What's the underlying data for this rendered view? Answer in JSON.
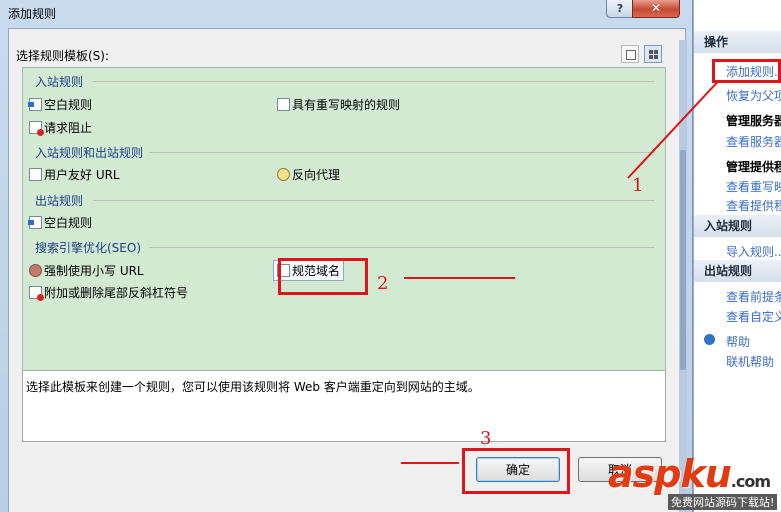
{
  "dialog": {
    "title": "添加规则",
    "help_glyph": "?",
    "close_glyph": "✕",
    "template_label": "选择规则模板(S):",
    "groups": [
      {
        "label": "入站规则",
        "items": [
          "空白规则",
          "具有重写映射的规则",
          "请求阻止"
        ]
      },
      {
        "label": "入站规则和出站规则",
        "items": [
          "用户友好 URL",
          "反向代理"
        ]
      },
      {
        "label": "出站规则",
        "items": [
          "空白规则"
        ]
      },
      {
        "label": "搜索引擎优化(SEO)",
        "items": [
          "强制使用小写 URL",
          "规范域名",
          "附加或删除尾部反斜杠符号"
        ]
      }
    ],
    "description": "选择此模板来创建一个规则，您可以使用该规则将 Web 客户端重定向到网站的主域。",
    "ok_label": "确定",
    "cancel_label": "取消"
  },
  "actions_panel": {
    "header": "操作",
    "add_rule": "添加规则...",
    "restore": "恢复为父项",
    "manage_server_vars": "管理服务器",
    "view_server_vars": "查看服务器",
    "manage_providers": "管理提供程",
    "view_rewrite_maps": "查看重写映",
    "view_providers": "查看提供程",
    "inbound_header": "入站规则",
    "import_rules": "导入规则...",
    "outbound_header": "出站规则",
    "view_preconditions": "查看前提条",
    "view_custom_tags": "查看自定义",
    "help": "帮助",
    "online_help": "联机帮助"
  },
  "annotations": {
    "step1": "1",
    "step2": "2",
    "step3": "3",
    "color": "#e0141b"
  },
  "watermark": {
    "brand": "aspku",
    "suffix": ".com",
    "tagline": "免费网站源码下载站!"
  }
}
